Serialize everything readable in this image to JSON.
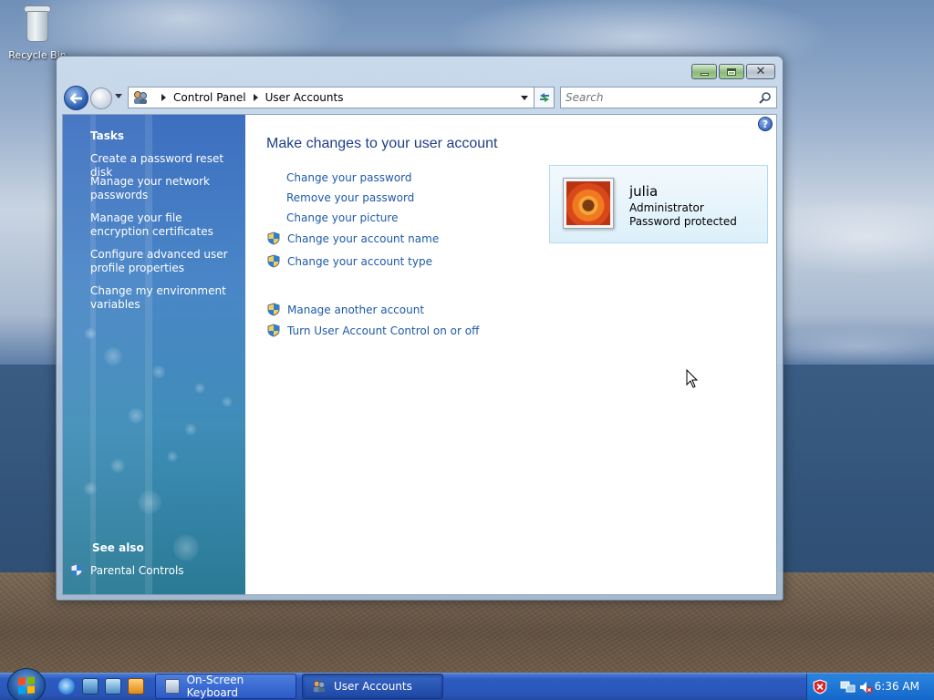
{
  "desktop": {
    "icon_label": "Recycle Bin"
  },
  "window": {
    "address": {
      "crumbs": [
        "Control Panel",
        "User Accounts"
      ]
    },
    "search": {
      "placeholder": "Search"
    },
    "help_label": "?"
  },
  "sidebar": {
    "tasks_heading": "Tasks",
    "links": [
      "Create a password reset disk",
      "Manage your network passwords",
      "Manage your file encryption certificates",
      "Configure advanced user profile properties",
      "Change my environment variables"
    ],
    "see_also_heading": "See also",
    "see_also_links": [
      "Parental Controls"
    ]
  },
  "main": {
    "title": "Make changes to your user account",
    "tasks": [
      "Change your password",
      "Remove your password",
      "Change your picture"
    ],
    "shield_tasks": [
      "Change your account name",
      "Change your account type"
    ],
    "other_tasks": [
      "Manage another account",
      "Turn User Account Control on or off"
    ]
  },
  "account": {
    "name": "julia",
    "type": "Administrator",
    "status": "Password protected"
  },
  "taskbar": {
    "buttons": [
      "On-Screen Keyboard",
      "User Accounts"
    ],
    "clock": "6:36 AM"
  },
  "colors": {
    "link": "#1e5aa8",
    "title": "#1e3e8a",
    "taskbar": "#2a55b7"
  }
}
